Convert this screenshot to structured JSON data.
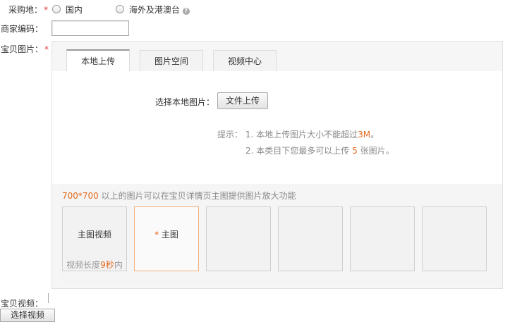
{
  "fields": {
    "purchase_location": {
      "label": "采购地：",
      "required": "*",
      "options": [
        {
          "label": "国内"
        },
        {
          "label": "海外及港澳台"
        }
      ],
      "help_icon": "?"
    },
    "merchant_code": {
      "label": "商家编码：",
      "value": ""
    },
    "item_images": {
      "label": "宝贝图片：",
      "required": "*"
    },
    "item_video": {
      "label": "宝贝视频：",
      "select_button": "选择视频"
    }
  },
  "upload_panel": {
    "tabs": [
      {
        "label": "本地上传"
      },
      {
        "label": "图片空间"
      },
      {
        "label": "视频中心"
      }
    ],
    "local_select_label": "选择本地图片：",
    "upload_button": "文件上传",
    "tip_prefix": "提示：",
    "tip_1_num": "1.",
    "tip_1_text": "本地上传图片大小不能超过",
    "tip_1_limit": "3M",
    "tip_1_end": "。",
    "tip_2_num": "2.",
    "tip_2_text": "本类目下您最多可以上传",
    "tip_2_count": "5",
    "tip_2_end": "张图片。"
  },
  "image_area": {
    "notice_size": "700*700",
    "notice_text": " 以上的图片可以在宝贝详情页主图提供图片放大功能",
    "main_video_slot": {
      "title": "主图视频",
      "limit_prefix": "视频长度",
      "limit_value": "9秒",
      "limit_suffix": "内"
    },
    "main_image_slot": {
      "star": "*",
      "title": "主图"
    }
  },
  "colors": {
    "accent": "#e46a1f",
    "required": "#e4393c"
  }
}
